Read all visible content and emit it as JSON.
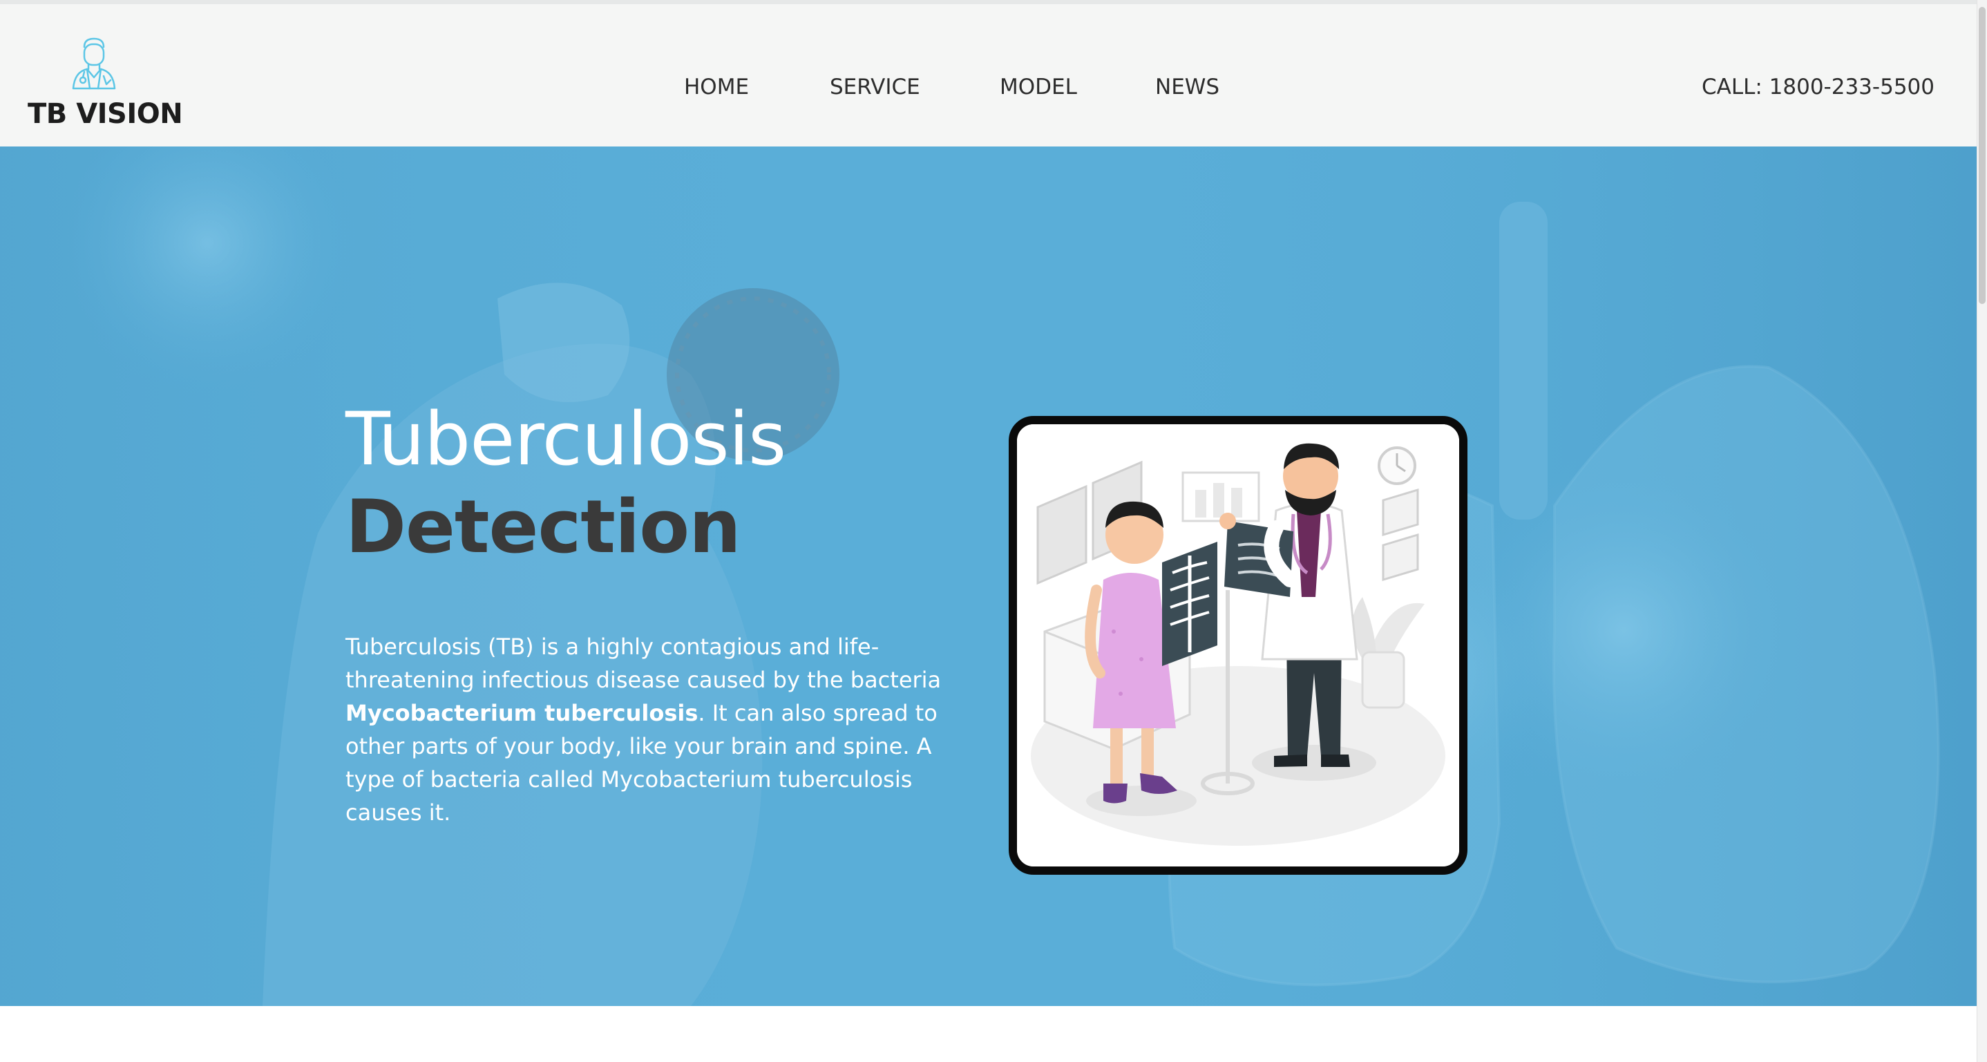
{
  "brand": {
    "name": "TB VISION",
    "logo_icon": "doctor-icon"
  },
  "nav": {
    "items": [
      {
        "label": "HOME"
      },
      {
        "label": "SERVICE"
      },
      {
        "label": "MODEL"
      },
      {
        "label": "NEWS"
      }
    ],
    "phone": "CALL: 1800-233-5500"
  },
  "hero": {
    "title_light": "Tuberculosis",
    "title_bold": "Detection",
    "description_part1": "Tuberculosis (TB) is a highly contagious and life-threatening infectious disease caused by the bacteria ",
    "description_bold": "Mycobacterium tuberculosis",
    "description_part2": ". It can also spread to other parts of your body, like your brain and spine. A type of bacteria called Mycobacterium tuberculosis causes it.",
    "illustration": "doctor-xray-illustration"
  },
  "colors": {
    "hero_background": "#5aaed8",
    "navbar_background": "#f5f6f5",
    "accent_icon": "#5cc6e6",
    "title_dark": "#3a3a3a"
  }
}
